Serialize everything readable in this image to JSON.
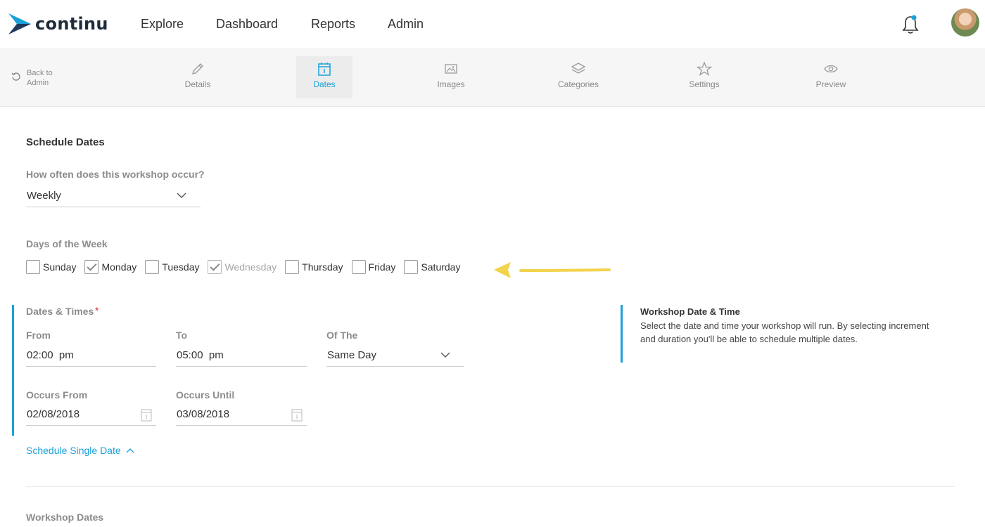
{
  "app": {
    "brand": "continu"
  },
  "topnav": {
    "links": [
      "Explore",
      "Dashboard",
      "Reports",
      "Admin"
    ]
  },
  "subnav": {
    "back_label": "Back to Admin",
    "steps": [
      {
        "label": "Details",
        "icon": "pencil-icon"
      },
      {
        "label": "Dates",
        "icon": "calendar-icon",
        "active": true
      },
      {
        "label": "Images",
        "icon": "image-icon"
      },
      {
        "label": "Categories",
        "icon": "layers-icon"
      },
      {
        "label": "Settings",
        "icon": "star-icon"
      },
      {
        "label": "Preview",
        "icon": "eye-icon"
      }
    ]
  },
  "schedule": {
    "heading": "Schedule Dates",
    "frequency_label": "How often does this workshop occur?",
    "frequency_value": "Weekly",
    "days_label": "Days of the Week",
    "days": [
      {
        "label": "Sunday",
        "checked": false
      },
      {
        "label": "Monday",
        "checked": true
      },
      {
        "label": "Tuesday",
        "checked": false
      },
      {
        "label": "Wednesday",
        "checked": true,
        "disabled": true
      },
      {
        "label": "Thursday",
        "checked": false
      },
      {
        "label": "Friday",
        "checked": false
      },
      {
        "label": "Saturday",
        "checked": false
      }
    ],
    "dates_times_label": "Dates & Times",
    "required_mark": "*",
    "from_label": "From",
    "from_value": "02:00  pm",
    "to_label": "To",
    "to_value": "05:00  pm",
    "of_the_label": "Of The",
    "of_the_value": "Same Day",
    "occurs_from_label": "Occurs From",
    "occurs_from_value": "02/08/2018",
    "occurs_until_label": "Occurs Until",
    "occurs_until_value": "03/08/2018",
    "single_date_link": "Schedule Single Date"
  },
  "info": {
    "title": "Workshop Date & Time",
    "text": "Select the date and time your workshop will run. By selecting increment and duration you'll be able to schedule multiple dates."
  },
  "workshop_dates": {
    "heading": "Workshop Dates"
  },
  "colors": {
    "accent": "#1aa1d8",
    "annotation_arrow": "#f2d34c",
    "required": "#e0434b"
  }
}
